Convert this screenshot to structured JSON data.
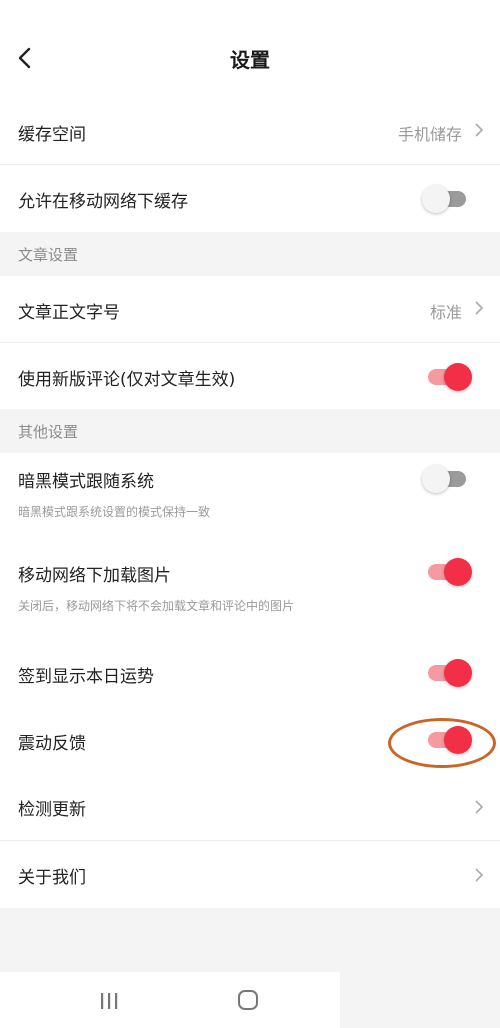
{
  "header": {
    "title": "设置"
  },
  "storage": {
    "label": "缓存空间",
    "value": "手机储存"
  },
  "mobile_cache": {
    "label": "允许在移动网络下缓存",
    "on": false
  },
  "article_section": {
    "title": "文章设置",
    "font_size": {
      "label": "文章正文字号",
      "value": "标准"
    },
    "new_comments": {
      "label": "使用新版评论(仅对文章生效)",
      "on": true
    }
  },
  "other_section": {
    "title": "其他设置",
    "dark_mode": {
      "label": "暗黑模式跟随系统",
      "sub": "暗黑模式跟系统设置的模式保持一致",
      "on": false
    },
    "load_images": {
      "label": "移动网络下加载图片",
      "sub": "关闭后，移动网络下将不会加载文章和评论中的图片",
      "on": true
    },
    "checkin_fortune": {
      "label": "签到显示本日运势",
      "on": true
    },
    "vibration": {
      "label": "震动反馈",
      "on": true
    },
    "check_update": {
      "label": "检测更新"
    },
    "about": {
      "label": "关于我们"
    }
  },
  "colors": {
    "accent": "#f22f46",
    "annotation": "#c8662a"
  }
}
